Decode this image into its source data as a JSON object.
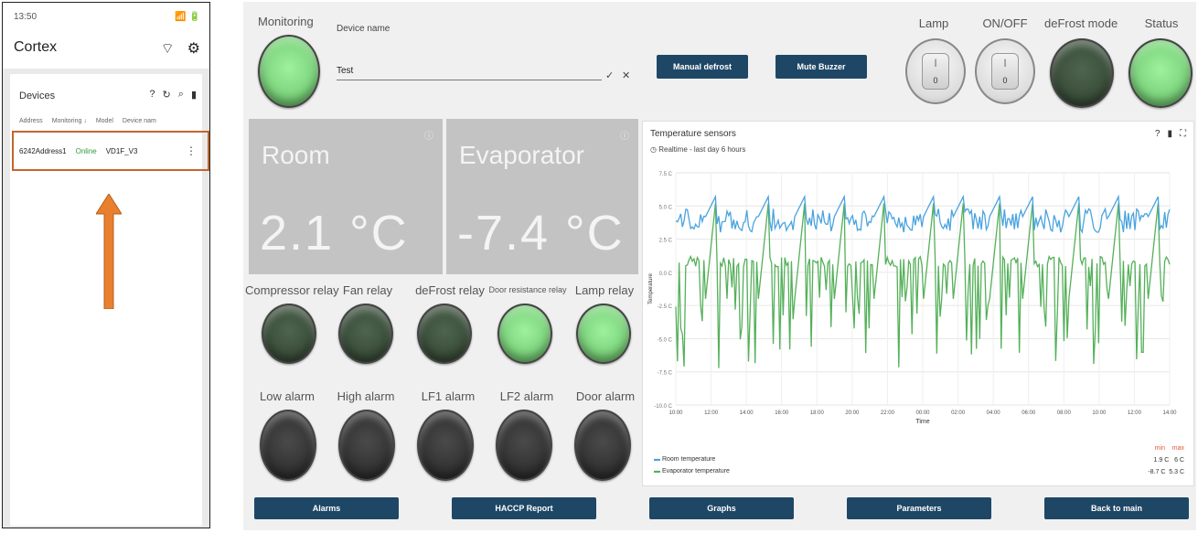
{
  "phone": {
    "time": "13:50",
    "status_icons": "📶 🔋",
    "app_title": "Cortex",
    "card_title": "Devices",
    "columns": [
      "Address",
      "Monitoring ↓",
      "Model",
      "Device nam"
    ],
    "device": {
      "address": "6242Address1",
      "monitoring": "Online",
      "model": "VD1F_V3"
    },
    "more": "⋮"
  },
  "dashboard": {
    "monitoring_label": "Monitoring",
    "device_name_label": "Device name",
    "device_name_value": "Test",
    "buttons": {
      "manual_defrost": "Manual defrost",
      "mute_buzzer": "Mute Buzzer"
    },
    "top_indicators": [
      {
        "label": "Lamp",
        "switch": "0"
      },
      {
        "label": "ON/OFF",
        "switch": "0"
      },
      {
        "label": "deFrost mode"
      },
      {
        "label": "Status"
      }
    ],
    "tiles": [
      {
        "title": "Room",
        "value": "2.1 °C"
      },
      {
        "title": "Evaporator",
        "value": "-7.4 °C"
      }
    ],
    "relays": [
      "Compressor relay",
      "Fan relay",
      "deFrost relay",
      "Door resistance relay",
      "Lamp relay"
    ],
    "relay_states": [
      "off",
      "off",
      "off",
      "on",
      "on"
    ],
    "alarms": [
      "Low alarm",
      "High alarm",
      "LF1 alarm",
      "LF2 alarm",
      "Door alarm"
    ],
    "bottom_buttons": [
      "Alarms",
      "HACCP Report",
      "Graphs",
      "Parameters",
      "Back to main"
    ]
  },
  "chart_data": {
    "type": "line",
    "title": "Temperature sensors",
    "subtitle": "Realtime - last day 6 hours",
    "xlabel": "Time",
    "ylabel": "Temperature",
    "x_ticks": [
      "10:00",
      "12:00",
      "14:00",
      "16:00",
      "18:00",
      "20:00",
      "22:00",
      "00:00",
      "02:00",
      "04:00",
      "06:00",
      "08:00",
      "10:00",
      "12:00",
      "14:00"
    ],
    "y_ticks": [
      "7.5 C",
      "5.0 C",
      "2.5 C",
      "0.0 C",
      "-2.5 C",
      "-5.0 C",
      "-7.5 C",
      "-10.0 C"
    ],
    "ylim": [
      -10,
      7.5
    ],
    "series": [
      {
        "name": "Room temperature",
        "color": "#4aa3df",
        "min": "1.9 C",
        "max": "6 C"
      },
      {
        "name": "Evaporator temperature",
        "color": "#55b05a",
        "min": "-8.7 C",
        "max": "5.3 C"
      }
    ],
    "min_label": "min",
    "max_label": "max"
  }
}
